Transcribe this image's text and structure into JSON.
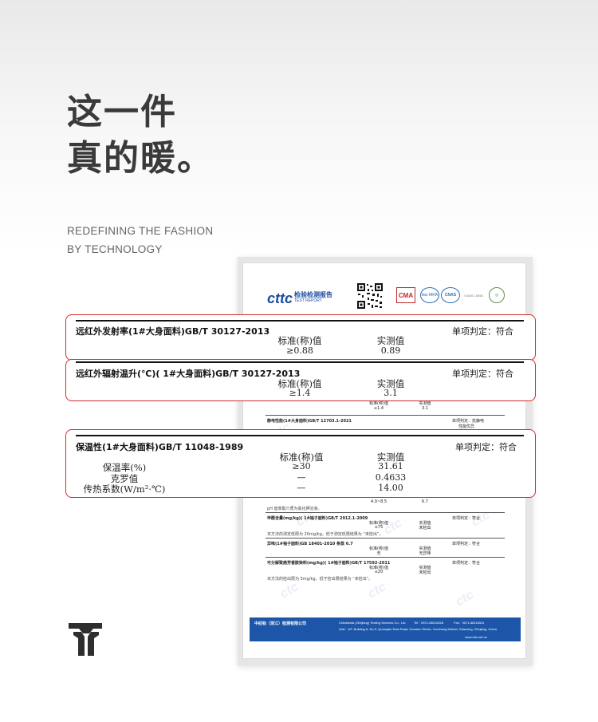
{
  "headline": {
    "line1": "这一件",
    "line2": "真的暖。"
  },
  "tagline": {
    "line1": "REDEFINING THE FASHION",
    "line2": "BY TECHNOLOGY"
  },
  "report": {
    "brand_mark": "cttc",
    "brand_cn": "检验检测报告",
    "brand_en": "TEST REPORT",
    "badges": [
      "CMA",
      "ilac-MRA",
      "CNAS",
      "CNAS L5058"
    ],
    "sections": [
      {
        "title": "静电性能(1#大身面料)GB/T 12703.1-2021",
        "judge": "单项判定：抗静电",
        "judge2": "性能优异",
        "std": "标准(称)值",
        "val": "实测值",
        "std_v": "≤1.4",
        "val_v": "3.1"
      },
      {
        "title": "甲醛含量(mg/kg)( 1#袖子面料)GB/T 2912.1-2009",
        "judge": "单项判定：符合",
        "std": "标准(称)值",
        "val": "实测值",
        "std_v": "≤75",
        "val_v": "未检出",
        "note": "本方法的测定低限为 20mg/kg，低于测定低限结果为 “未检出”。"
      },
      {
        "title": "异味(1#袖子面料)GB 18401-2010 条款 6.7",
        "judge": "单项判定：符合",
        "std": "标准(称)值",
        "val": "实测值",
        "std_v": "无",
        "val_v": "无异味"
      },
      {
        "title": "可分解致癌芳香胺染料(mg/kg)( 1#袖子面料)GB/T 17592-2011",
        "judge": "单项判定：符合",
        "std": "标准(称)值",
        "val": "实测值",
        "std_v": "≤20",
        "val_v": "未检出",
        "note": "本方法的检出限为 5mg/kg，低于检出限结果为 “未检出”。"
      }
    ],
    "ph_values": {
      "std_v": "4.0~8.5",
      "val_v": "6.7",
      "note": "pH 值萃取介质为氯化钾溶液。"
    },
    "footer": {
      "company_cn": "中纺标（浙江）检测有限公司",
      "company_en": "Chinatesta (Zhejiang) Testing Services Co., Ltd",
      "tel": "Tel：0571-88216518",
      "fax": "Fax：0571-88216511",
      "address": "Add：4/F, Building 6, No.9, Quanqian East Road, Doumen Street, Yuecheng District, Shaoxing, Zhejiang, China",
      "web": "www.cttc.net.cn"
    }
  },
  "callouts": [
    {
      "title": "远红外发射率(1#大身面料)GB/T 30127-2013",
      "judge": "单项判定：符合",
      "std_header": "标准(称)值",
      "val_header": "实测值",
      "std_value": "≥0.88",
      "measured": "0.89"
    },
    {
      "title": "远红外辐射温升(℃)( 1#大身面料)GB/T 30127-2013",
      "judge": "单项判定：符合",
      "std_header": "标准(称)值",
      "val_header": "实测值",
      "std_value": "≥1.4",
      "measured": "3.1"
    },
    {
      "title": "保温性(1#大身面料)GB/T 11048-1989",
      "judge": "单项判定：符合",
      "std_header": "标准(称)值",
      "val_header": "实测值",
      "rows": [
        {
          "name": "保温率(%)",
          "std": "≥30",
          "val": "31.61"
        },
        {
          "name": "克罗值",
          "std": "—",
          "val": "0.4633"
        },
        {
          "name": "传热系数(W/m²·℃)",
          "std": "—",
          "val": "14.00"
        }
      ]
    }
  ],
  "colors": {
    "callout_border": "#d22b2b",
    "brand_blue": "#1d56a8",
    "headline": "#3a3a3a"
  }
}
